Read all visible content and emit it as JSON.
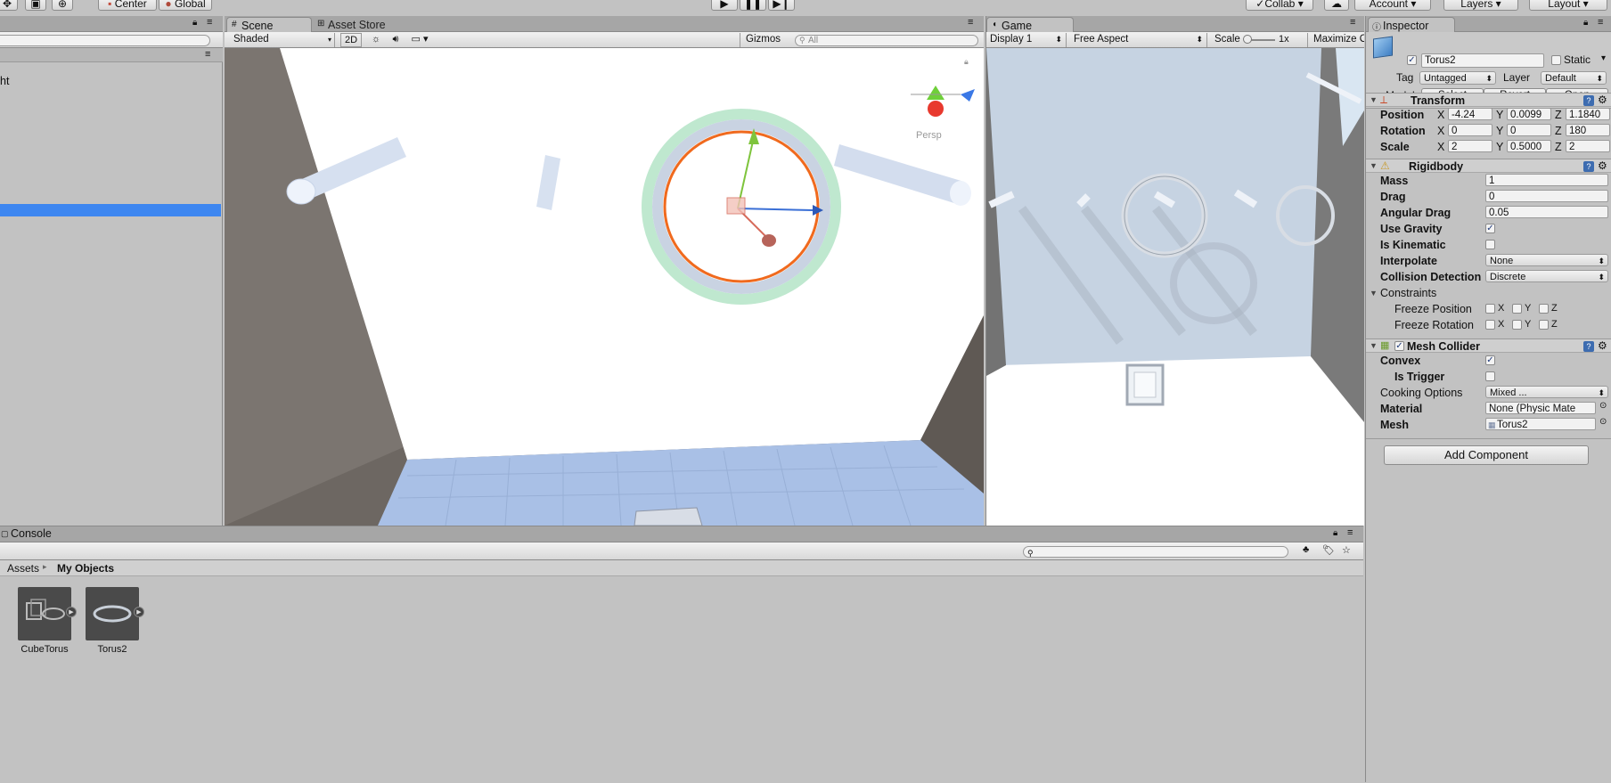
{
  "toolbar": {
    "pivot": "Center",
    "space": "Global",
    "collab": "Collab",
    "account": "Account",
    "layers": "Layers",
    "layout": "Layout"
  },
  "hierarchy": {
    "partial_item": "ht"
  },
  "scene": {
    "tab_scene": "Scene",
    "tab_asset_store": "Asset Store",
    "shading": "Shaded",
    "mode_2d": "2D",
    "gizmos": "Gizmos",
    "search_placeholder": "All",
    "persp": "Persp"
  },
  "game": {
    "tab": "Game",
    "display": "Display 1",
    "aspect": "Free Aspect",
    "scale_label": "Scale",
    "scale_value": "1x",
    "maximize": "Maximize O"
  },
  "inspector": {
    "tab": "Inspector",
    "object_name": "Torus2",
    "static_label": "Static",
    "tag_label": "Tag",
    "tag_value": "Untagged",
    "layer_label": "Layer",
    "layer_value": "Default",
    "model_label": "Model",
    "model_select": "Select",
    "model_revert": "Revert",
    "model_open": "Open",
    "transform": {
      "title": "Transform",
      "position_label": "Position",
      "rotation_label": "Rotation",
      "scale_label": "Scale",
      "x": "X",
      "y": "Y",
      "z": "Z",
      "position": [
        "-4.24",
        "0.0099",
        "1.1840"
      ],
      "rotation": [
        "0",
        "0",
        "180"
      ],
      "scale": [
        "2",
        "0.5000",
        "2"
      ]
    },
    "rigidbody": {
      "title": "Rigidbody",
      "mass_label": "Mass",
      "mass": "1",
      "drag_label": "Drag",
      "drag": "0",
      "angular_label": "Angular Drag",
      "angular": "0.05",
      "gravity_label": "Use Gravity",
      "kinematic_label": "Is Kinematic",
      "interpolate_label": "Interpolate",
      "interpolate": "None",
      "collision_label": "Collision Detection",
      "collision": "Discrete",
      "constraints_label": "Constraints",
      "freeze_pos_label": "Freeze Position",
      "freeze_rot_label": "Freeze Rotation"
    },
    "mesh_collider": {
      "title": "Mesh Collider",
      "convex_label": "Convex",
      "trigger_label": "Is Trigger",
      "cooking_label": "Cooking Options",
      "cooking": "Mixed ...",
      "material_label": "Material",
      "material": "None (Physic Mate",
      "mesh_label": "Mesh",
      "mesh": "Torus2"
    },
    "add_component": "Add Component"
  },
  "console": {
    "tab": "Console"
  },
  "project": {
    "breadcrumb_root": "Assets",
    "breadcrumb_current": "My Objects",
    "assets": [
      "CubeTorus",
      "Torus2"
    ]
  }
}
